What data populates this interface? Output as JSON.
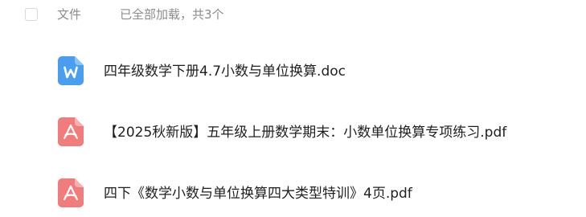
{
  "header": {
    "column_label": "文件",
    "status_text": "已全部加载，共3个"
  },
  "files": [
    {
      "name": "四年级数学下册4.7小数与单位换算.doc",
      "type": "doc",
      "icon": "word-document-icon",
      "icon_color": "#4a9ef0",
      "icon_letter": "W"
    },
    {
      "name": "【2025秋新版】五年级上册数学期末：小数单位换算专项练习.pdf",
      "type": "pdf",
      "icon": "pdf-document-icon",
      "icon_color": "#f07c7c"
    },
    {
      "name": "四下《数学小数与单位换算四大类型特训》4页.pdf",
      "type": "pdf",
      "icon": "pdf-document-icon",
      "icon_color": "#f07c7c"
    }
  ]
}
